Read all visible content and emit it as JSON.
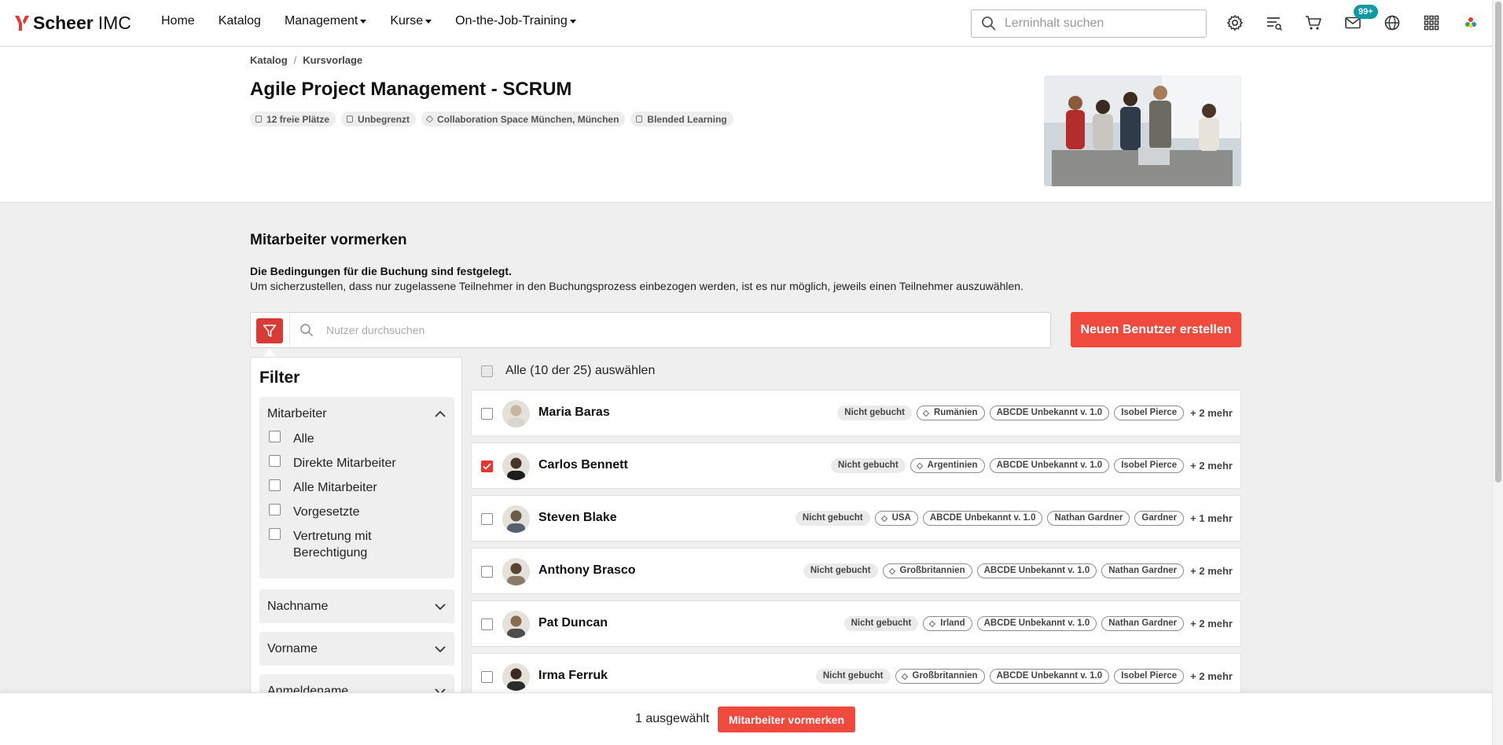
{
  "brand": {
    "name": "Scheer",
    "suffix": "IMC",
    "accent": "#f04a3f"
  },
  "nav": {
    "items": [
      {
        "label": "Home",
        "dropdown": false
      },
      {
        "label": "Katalog",
        "dropdown": false
      },
      {
        "label": "Management",
        "dropdown": true
      },
      {
        "label": "Kurse",
        "dropdown": true
      },
      {
        "label": "On-the-Job-Training",
        "dropdown": true
      }
    ],
    "search_placeholder": "Lerninhalt suchen",
    "icons": [
      "settings-icon",
      "learning-list-icon",
      "cart-icon",
      "mail-icon",
      "globe-icon",
      "apps-grid-icon",
      "profile-logo-icon"
    ],
    "mail_badge": "99+"
  },
  "breadcrumb": [
    "Katalog",
    "Kursvorlage"
  ],
  "course": {
    "title": "Agile Project Management - SCRUM",
    "chips": [
      {
        "icon": "seat-icon",
        "label": "12 freie Plätze"
      },
      {
        "icon": "calendar-icon",
        "label": "Unbegrenzt"
      },
      {
        "icon": "location-icon",
        "label": "Collaboration Space München, München"
      },
      {
        "icon": "blended-icon",
        "label": "Blended Learning"
      }
    ]
  },
  "section": {
    "title": "Mitarbeiter vormerken",
    "conditions_bold": "Die Bedingungen für die Buchung sind festgelegt.",
    "conditions_text": "Um sicherzustellen, dass nur zugelassene Teilnehmer in den Buchungsprozess einbezogen werden, ist es nur möglich, jeweils einen Teilnehmer auszuwählen.",
    "user_search_placeholder": "Nutzer durchsuchen",
    "new_user_label": "Neuen Benutzer erstellen"
  },
  "filter": {
    "title": "Filter",
    "groups": [
      {
        "label": "Mitarbeiter",
        "expanded": true,
        "options": [
          "Alle",
          "Direkte Mitarbeiter",
          "Alle Mitarbeiter",
          "Vorgesetzte",
          "Vertretung mit Berechtigung"
        ]
      },
      {
        "label": "Nachname",
        "expanded": false
      },
      {
        "label": "Vorname",
        "expanded": false
      },
      {
        "label": "Anmeldename",
        "expanded": false
      }
    ]
  },
  "list": {
    "select_all_label": "Alle (10 der 25) auswählen",
    "users": [
      {
        "name": "Maria Baras",
        "checked": false,
        "status": "Nicht gebucht",
        "country": "Rumänien",
        "tags": [
          "ABCDE Unbekannt v. 1.0",
          "Isobel Pierce"
        ],
        "more": "+ 2 mehr"
      },
      {
        "name": "Carlos Bennett",
        "checked": true,
        "status": "Nicht gebucht",
        "country": "Argentinien",
        "tags": [
          "ABCDE Unbekannt v. 1.0",
          "Isobel Pierce"
        ],
        "more": "+ 2 mehr"
      },
      {
        "name": "Steven Blake",
        "checked": false,
        "status": "Nicht gebucht",
        "country": "USA",
        "tags": [
          "ABCDE Unbekannt v. 1.0",
          "Nathan Gardner",
          "Gardner"
        ],
        "more": "+ 1 mehr"
      },
      {
        "name": "Anthony Brasco",
        "checked": false,
        "status": "Nicht gebucht",
        "country": "Großbritannien",
        "tags": [
          "ABCDE Unbekannt v. 1.0",
          "Nathan Gardner"
        ],
        "more": "+ 2 mehr"
      },
      {
        "name": "Pat Duncan",
        "checked": false,
        "status": "Nicht gebucht",
        "country": "Irland",
        "tags": [
          "ABCDE Unbekannt v. 1.0",
          "Nathan Gardner"
        ],
        "more": "+ 2 mehr"
      },
      {
        "name": "Irma Ferruk",
        "checked": false,
        "status": "Nicht gebucht",
        "country": "Großbritannien",
        "tags": [
          "ABCDE Unbekannt v. 1.0",
          "Isobel Pierce"
        ],
        "more": "+ 2 mehr"
      }
    ]
  },
  "footer": {
    "selected_text": "1 ausgewählt",
    "reserve_label": "Mitarbeiter vormerken"
  }
}
